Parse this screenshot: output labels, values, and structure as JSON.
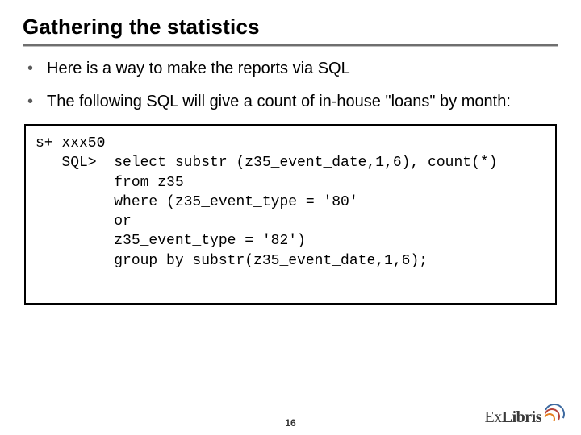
{
  "title": "Gathering the statistics",
  "bullets": [
    "Here is a way to make the reports via SQL",
    "The following SQL will give a count of in-house \"loans\" by month:"
  ],
  "code": "s+ xxx50\n   SQL>  select substr (z35_event_date,1,6), count(*)\n         from z35\n         where (z35_event_type = '80'\n         or\n         z35_event_type = '82')\n         group by substr(z35_event_date,1,6);",
  "page_number": "16",
  "logo": {
    "part1": "Ex",
    "part2": "Libris"
  }
}
